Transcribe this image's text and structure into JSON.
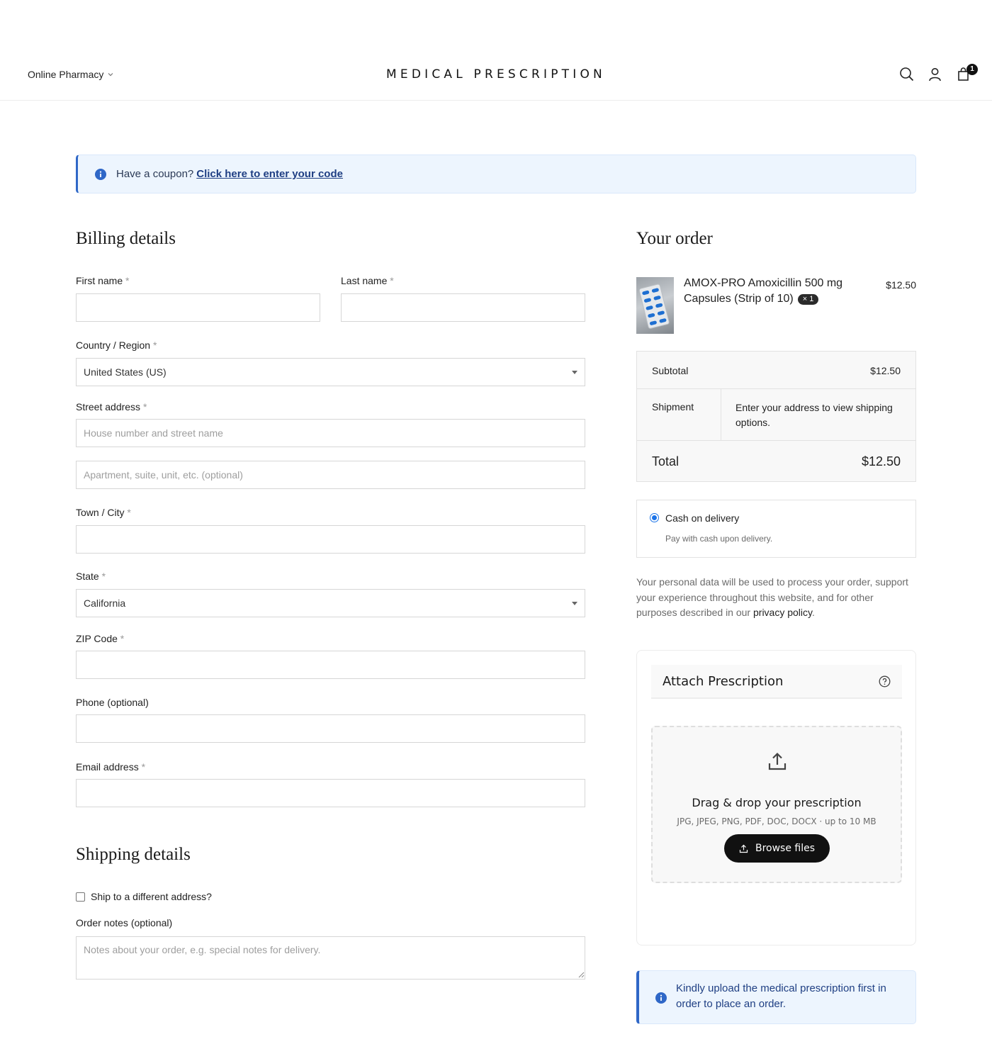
{
  "header": {
    "nav_left": "Online Pharmacy",
    "brand": "MEDICAL PRESCRIPTION",
    "cart_count": "1"
  },
  "coupon": {
    "text": "Have a coupon?",
    "link": "Click here to enter your code"
  },
  "billing": {
    "title": "Billing details",
    "required_mark": "*",
    "first_name_label": "First name",
    "last_name_label": "Last name",
    "country_label": "Country / Region",
    "country_value": "United States (US)",
    "street_label": "Street address",
    "street_placeholder": "House number and street name",
    "street2_placeholder": "Apartment, suite, unit, etc. (optional)",
    "city_label": "Town / City",
    "state_label": "State",
    "state_value": "California",
    "zip_label": "ZIP Code",
    "phone_label": "Phone (optional)",
    "email_label": "Email address"
  },
  "shipping": {
    "title": "Shipping details",
    "ship_diff_label": "Ship to a different address?",
    "notes_label": "Order notes (optional)",
    "notes_placeholder": "Notes about your order, e.g. special notes for delivery."
  },
  "order": {
    "title": "Your order",
    "product_name": "AMOX-PRO Amoxicillin 500 mg Capsules (Strip of 10)",
    "product_qty": "× 1",
    "product_price": "$12.50",
    "subtotal_label": "Subtotal",
    "subtotal_value": "$12.50",
    "shipment_label": "Shipment",
    "shipment_value": "Enter your address to view shipping options.",
    "total_label": "Total",
    "total_value": "$12.50",
    "payment_method": "Cash on delivery",
    "payment_desc": "Pay with cash upon delivery.",
    "privacy_text": "Your personal data will be used to process your order, support your experience throughout this website, and for other purposes described in our",
    "privacy_link": "privacy policy",
    "privacy_end": "."
  },
  "prescription": {
    "title": "Attach Prescription",
    "drop_title": "Drag & drop your prescription",
    "drop_sub": "JPG, JPEG, PNG, PDF, DOC, DOCX · up to 10 MB",
    "browse_label": "Browse files",
    "notice": "Kindly upload the medical prescription first in order to place an order."
  },
  "colors": {
    "accent_blue": "#2f67c7",
    "notice_bg": "#edf5fe",
    "button_dark": "#111111"
  }
}
